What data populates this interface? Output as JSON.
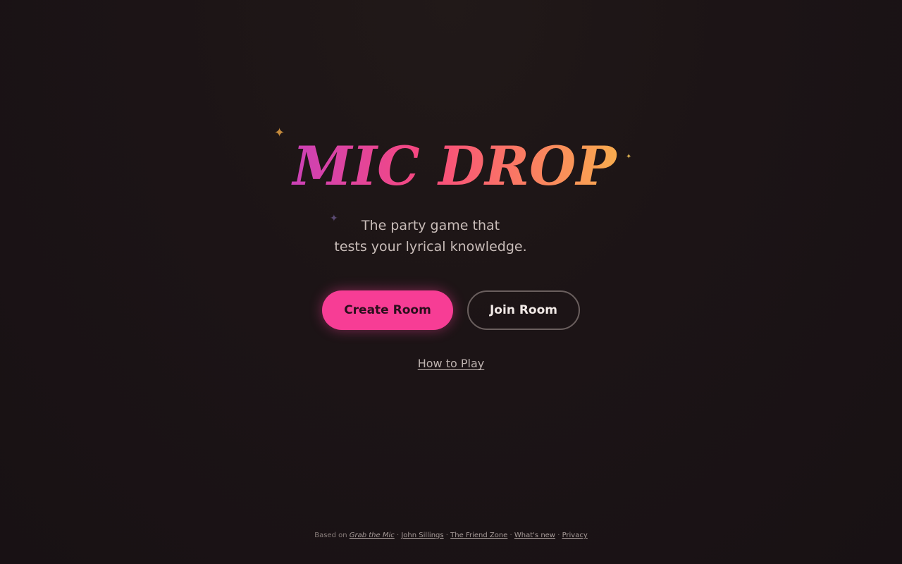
{
  "hero": {
    "title": "MIC DROP",
    "tagline_line1": "The party game that",
    "tagline_line2": "tests your lyrical knowledge.",
    "title_gradient": [
      "#c43fbf",
      "#f8497e",
      "#fa7a63",
      "#f8b64a"
    ]
  },
  "actions": {
    "create_room": "Create Room",
    "join_room": "Join Room",
    "how_to_play": "How to Play"
  },
  "footer": {
    "based_on": "Based on",
    "source_title": "Grab the Mic",
    "sep": "·",
    "author": "John Sillings",
    "community": "The Friend Zone",
    "whats_new": "What's new",
    "privacy": "Privacy"
  },
  "colors": {
    "background": "#1c1416",
    "accent": "#f73d95",
    "sparkle_gold": "#c48a3c",
    "sparkle_purple": "#5a4a72"
  },
  "icons": {
    "sparkle": "four-point-star-icon"
  }
}
